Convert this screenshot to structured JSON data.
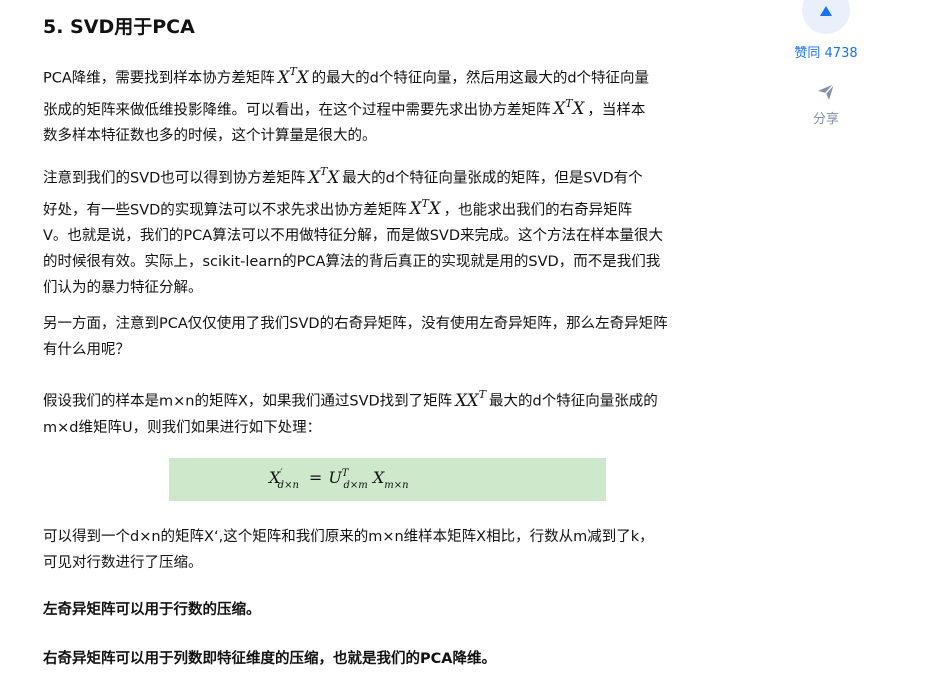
{
  "heading": "5. SVD用于PCA",
  "p1": {
    "t1": "PCA降维，需要找到样本协方差矩阵",
    "t2": "的最大的d个特征向量，然后用这最大的d个特征向量",
    "t3": "张成的矩阵来做低维投影降维。可以看出，在这个过程中需要先求出协方差矩阵",
    "t4": "，当样本",
    "t5": "数多样本特征数也多的时候，这个计算量是很大的。"
  },
  "p2": {
    "t1": "注意到我们的SVD也可以得到协方差矩阵",
    "t2": "最大的d个特征向量张成的矩阵，但是SVD有个",
    "t3": "好处，有一些SVD的实现算法可以不求先求出协方差矩阵",
    "t4": "，也能求出我们的右奇异矩阵",
    "t5": "V。也就是说，我们的PCA算法可以不用做特征分解，而是做SVD来完成。这个方法在样本量很大",
    "t6": "的时候很有效。实际上，scikit-learn的PCA算法的背后真正的实现就是用的SVD，而不是我们我",
    "t7": "们认为的暴力特征分解。"
  },
  "p3": {
    "t1": "另一方面，注意到PCA仅仅使用了我们SVD的右奇异矩阵，没有使用左奇异矩阵，那么左奇异矩阵",
    "t2": "有什么用呢？"
  },
  "p4": {
    "t1": "假设我们的样本是m×n的矩阵X，如果我们通过SVD找到了矩阵",
    "t2": "最大的d个特征向量张成的",
    "t3": "m×d维矩阵U，则我们如果进行如下处理："
  },
  "math": {
    "X": "X",
    "T": "T",
    "XX": "XX"
  },
  "formula": {
    "lhs": "X",
    "lhs_prime": "′",
    "lhs_sub": "d×n",
    "eq": "=",
    "u": "U",
    "u_sup": "T",
    "u_sub": "d×m",
    "x": "X",
    "x_sub": "m×n"
  },
  "p5": {
    "t1": "可以得到一个d×n的矩阵X‘,这个矩阵和我们原来的m×n维样本矩阵X相比，行数从m减到了k，",
    "t2": "可见对行数进行了压缩。"
  },
  "bold1": "左奇异矩阵可以用于行数的压缩。",
  "bold2": "右奇异矩阵可以用于列数即特征维度的压缩，也就是我们的PCA降维。",
  "sidebar": {
    "vote_label": "赞同 4738",
    "share_label": "分享",
    "accent_color": "#1772f6",
    "muted_color": "#8590a6",
    "vote_icon": "triangle-up-icon",
    "share_icon": "paper-plane-icon"
  }
}
